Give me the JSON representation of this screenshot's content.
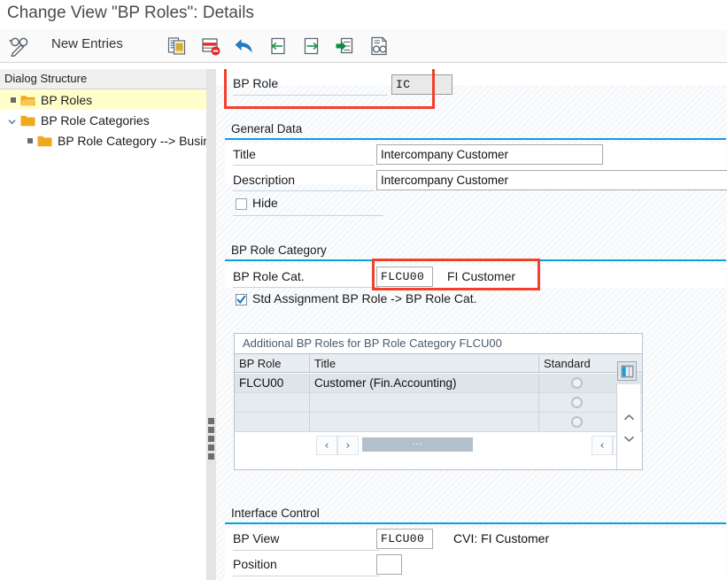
{
  "window": {
    "title": "Change View \"BP Roles\": Details"
  },
  "toolbar": {
    "new_entries_label": "New Entries",
    "icons": [
      {
        "name": "display-change-icon",
        "title": "Display <-> Change"
      },
      {
        "name": "copy-entry-icon",
        "title": "Copy As..."
      },
      {
        "name": "delete-entry-icon",
        "title": "Delete"
      },
      {
        "name": "undo-icon",
        "title": "Undo"
      },
      {
        "name": "previous-entry-icon",
        "title": "Previous Entry"
      },
      {
        "name": "next-entry-icon",
        "title": "Next Entry"
      },
      {
        "name": "select-entry-icon",
        "title": "Select Entry"
      },
      {
        "name": "documentation-icon",
        "title": "Documentation"
      }
    ]
  },
  "sidebar": {
    "header": "Dialog Structure",
    "items": [
      {
        "label": "BP Roles",
        "selected": true,
        "level": 0,
        "marker": "bullet"
      },
      {
        "label": "BP Role Categories",
        "selected": false,
        "level": 0,
        "marker": "chevron"
      },
      {
        "label": "BP Role Category --> Busine",
        "selected": false,
        "level": 1,
        "marker": "bullet"
      }
    ]
  },
  "main": {
    "bp_role": {
      "label": "BP Role",
      "value": "IC",
      "highlighted": true
    },
    "general_data": {
      "section_title": "General Data",
      "title_label": "Title",
      "title_value": "Intercompany Customer",
      "description_label": "Description",
      "description_value": "Intercompany Customer",
      "hide_label": "Hide",
      "hide_checked": false
    },
    "bp_role_category": {
      "section_title": "BP Role Category",
      "cat_label": "BP Role Cat.",
      "cat_value": "FLCU00",
      "cat_text": "FI Customer",
      "highlighted": true,
      "std_assignment_label": "Std Assignment BP Role -> BP Role Cat.",
      "std_assignment_checked": true
    },
    "additional_roles_table": {
      "caption": "Additional BP Roles for BP Role Category FLCU00",
      "columns": [
        "BP Role",
        "Title",
        "Standard"
      ],
      "rows": [
        {
          "bp_role": "FLCU00",
          "title": "Customer (Fin.Accounting)",
          "standard": false
        },
        {
          "bp_role": "",
          "title": "",
          "standard": false
        },
        {
          "bp_role": "",
          "title": "",
          "standard": false
        }
      ],
      "grid_config_icon": "table-settings-icon",
      "scroll_up_icon": "chevron-up-icon",
      "scroll_down_icon": "chevron-down-icon",
      "scroll_left_icon": "chevron-left-icon",
      "scroll_right_icon": "chevron-right-icon"
    },
    "interface_control": {
      "section_title": "Interface Control",
      "bp_view_label": "BP View",
      "bp_view_value": "FLCU00",
      "bp_view_text": "CVI: FI Customer",
      "position_label": "Position",
      "position_value": ""
    }
  },
  "colors": {
    "accent_rule": "#0aa1e0",
    "highlight_box": "#f2402c",
    "tree_selection": "#ffffcc",
    "folder": "#f2a71b"
  }
}
